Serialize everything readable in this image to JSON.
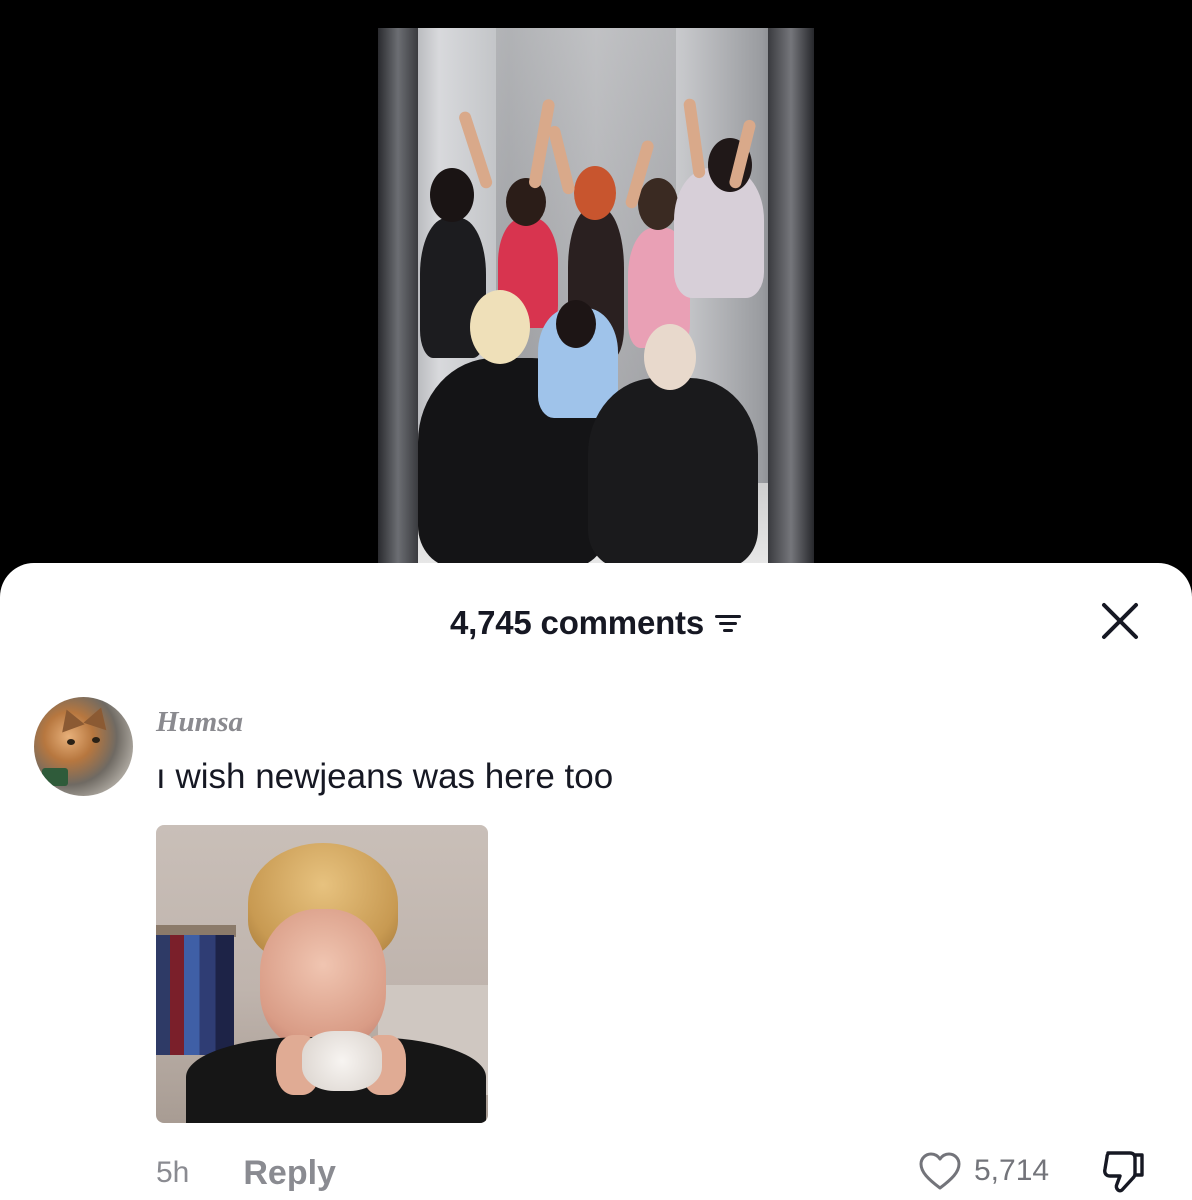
{
  "comments_sheet": {
    "count_label": "4,745 comments",
    "close_icon": "close-icon",
    "filter_icon": "filter-icon"
  },
  "comment": {
    "username": "Humsa",
    "text": "ı wish newjeans was here too",
    "time": "5h",
    "reply_label": "Reply",
    "like_count": "5,714",
    "like_icon": "heart-icon",
    "dislike_icon": "thumbs-down-icon",
    "avatar_icon": "cat-avatar"
  },
  "colors": {
    "sheet_bg": "#ffffff",
    "primary_text": "#161823",
    "secondary_text": "#8a8b91",
    "background": "#000000"
  }
}
